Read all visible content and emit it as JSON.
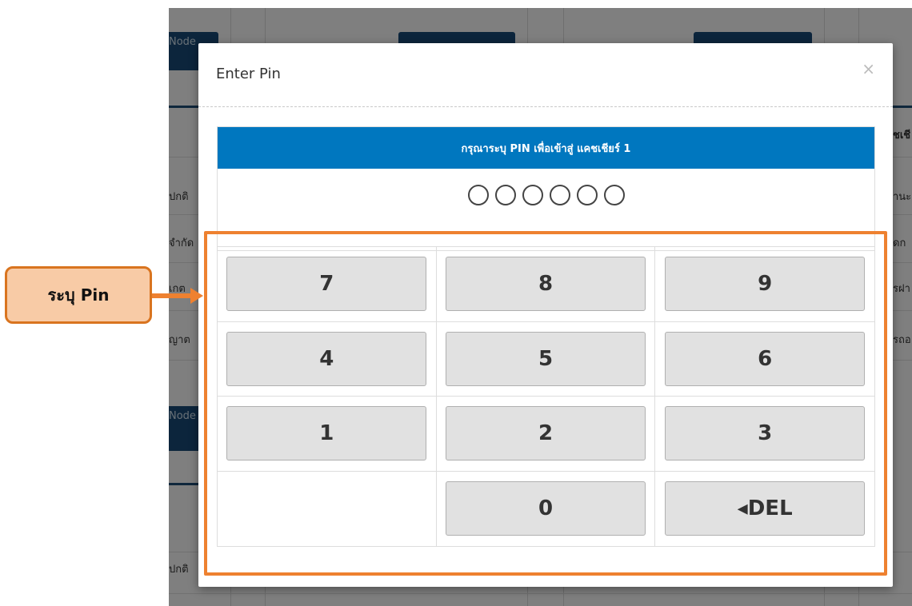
{
  "background": {
    "buttons": [
      "Node",
      "Node"
    ],
    "left_texts": [
      "ปกติ",
      "จำกัด",
      "เกต",
      "ญาต",
      "ปกติ"
    ],
    "right_texts": [
      "ชเชี",
      "านะ",
      "ัดก",
      "รฝา",
      "รถอ"
    ]
  },
  "modal": {
    "title": "Enter Pin",
    "close_label": "×",
    "prompt": "กรุณาระบุ PIN เพื่อเข้าสู่ แคชเชียร์ 1",
    "pin_length": 6
  },
  "keypad": {
    "keys": [
      "7",
      "8",
      "9",
      "4",
      "5",
      "6",
      "1",
      "2",
      "3",
      "",
      "0",
      "◂DEL"
    ]
  },
  "annotation": {
    "label": "ระบุ Pin",
    "color": "#ee8130",
    "fill": "#f8cba6"
  }
}
